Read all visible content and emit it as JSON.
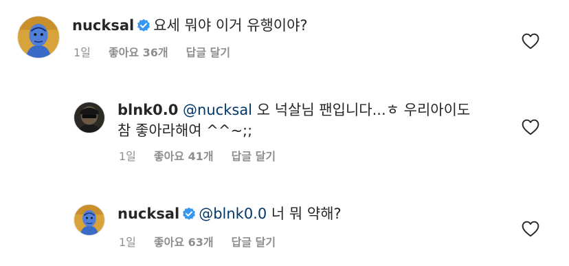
{
  "comments": [
    {
      "username": "nucksal",
      "verified": true,
      "text": "요세 뭐야 이거 유행이야?",
      "time": "1일",
      "likes": "좋아요 36개",
      "reply": "답글 달기",
      "avatar": "painted-portrait-avatar"
    },
    {
      "username": "blnk0.0",
      "verified": false,
      "mention": "@nucksal",
      "text_line1": "오 넉살님 팬입니다...ㅎ 우리아이도",
      "text_line2": "참 좋아라해여 ^^~;;",
      "time": "1일",
      "likes": "좋아요 41개",
      "reply": "답글 달기",
      "avatar": "dark-photo-avatar"
    },
    {
      "username": "nucksal",
      "verified": true,
      "mention": "@blnk0.0",
      "text": "너 뭐 약해?",
      "time": "1일",
      "likes": "좋아요 63개",
      "reply": "답글 달기",
      "avatar": "painted-portrait-avatar"
    }
  ],
  "colors": {
    "text": "#262626",
    "meta": "#8e8e8e",
    "mention": "#00376b",
    "verified": "#3897f0"
  },
  "icons": {
    "like": "heart-outline-icon",
    "verified": "verified-badge-icon"
  }
}
